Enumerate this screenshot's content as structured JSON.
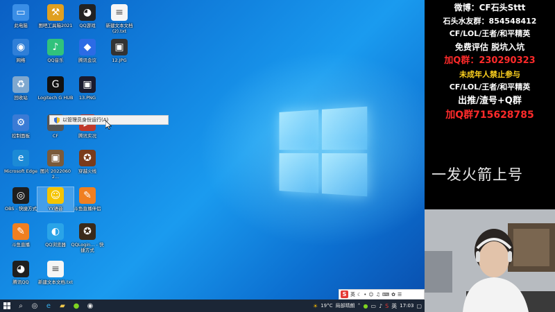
{
  "desktop": {
    "icons": [
      {
        "label": "此电脑",
        "icon": "computer-icon",
        "color": "#3a8ee6",
        "glyph": "▭"
      },
      {
        "label": "图吧工具箱2021",
        "icon": "toolbox-icon",
        "color": "#e0a020",
        "glyph": "⚒"
      },
      {
        "label": "QQ游戏",
        "icon": "qq-game-icon",
        "color": "#222222",
        "glyph": "◕"
      },
      {
        "label": "新建文本文档 (2).txt",
        "icon": "text-file-icon",
        "color": "#f5f5f5",
        "glyph": "≡"
      },
      {
        "label": "网络",
        "icon": "network-icon",
        "color": "#2f7fd8",
        "glyph": "◉"
      },
      {
        "label": "QQ音乐",
        "icon": "qq-music-icon",
        "color": "#31c27c",
        "glyph": "♪"
      },
      {
        "label": "腾讯会议",
        "icon": "tencent-meeting-icon",
        "color": "#2c6be5",
        "glyph": "◆"
      },
      {
        "label": "12.JPG",
        "icon": "image-file-icon",
        "color": "#333333",
        "glyph": "▣"
      },
      {
        "label": "回收站",
        "icon": "recycle-bin-icon",
        "color": "#7fa8cf",
        "glyph": "♻"
      },
      {
        "label": "Logitech G HUB",
        "icon": "logitech-icon",
        "color": "#111111",
        "glyph": "G"
      },
      {
        "label": "13.PNG",
        "icon": "image-file-icon",
        "color": "#1a1a2e",
        "glyph": "▣"
      },
      {
        "label": "控制面板",
        "icon": "control-panel-icon",
        "color": "#3a7bd5",
        "glyph": "⚙"
      },
      {
        "label": "CF",
        "icon": "cf-game-icon",
        "color": "#555555",
        "glyph": "✦"
      },
      {
        "label": "腾讯实况",
        "icon": "tencent-live-icon",
        "color": "#c0392b",
        "glyph": "▶"
      },
      {
        "label": "Microsoft Edge",
        "icon": "edge-icon",
        "color": "#1c8ad6",
        "glyph": "e"
      },
      {
        "label": "图片 20220602...",
        "icon": "photo-icon",
        "color": "#7a5a3a",
        "glyph": "▣"
      },
      {
        "label": "穿越火线",
        "icon": "crossfire-icon",
        "color": "#7a3b1a",
        "glyph": "✪"
      },
      {
        "label": "OBS - 快捷方式",
        "icon": "obs-icon",
        "color": "#1e1e1e",
        "glyph": "◎"
      },
      {
        "label": "YY语音",
        "icon": "yy-icon",
        "color": "#f5c400",
        "glyph": "☺"
      },
      {
        "label": "斗鱼直播伴侣",
        "icon": "douyu-companion-icon",
        "color": "#f07f20",
        "glyph": "✎"
      },
      {
        "label": "斗鱼直播",
        "icon": "douyu-icon",
        "color": "#f07f20",
        "glyph": "✎"
      },
      {
        "label": "QQ浏览器",
        "icon": "qq-browser-icon",
        "color": "#2aa4e8",
        "glyph": "◐"
      },
      {
        "label": "QQLogin... - 快捷方式",
        "icon": "qq-login-icon",
        "color": "#3a2a1a",
        "glyph": "✪"
      },
      {
        "label": "腾讯QQ",
        "icon": "qq-icon",
        "color": "#1f1f1f",
        "glyph": "◕"
      },
      {
        "label": "新建文本文档.txt",
        "icon": "text-file-icon",
        "color": "#f5f5f5",
        "glyph": "≡"
      }
    ],
    "context_item": "以管理员身份运行(A)"
  },
  "taskbar": {
    "weather": "19°C",
    "weather_desc": "局部晴朗",
    "clock": "17:03"
  },
  "ime": {
    "logo": "S",
    "lang": "英"
  },
  "side_panel": {
    "lines": [
      {
        "text": "微博：CF石头Sttt",
        "color": "#ffffff",
        "size": 12
      },
      {
        "text": "石头水友群：854548412",
        "color": "#ffffff",
        "size": 11
      },
      {
        "text": "CF/LOL/王者/和平精英",
        "color": "#ffffff",
        "size": 11
      },
      {
        "text": "免费评估 脱坑入坑",
        "color": "#ffffff",
        "size": 12
      },
      {
        "text": "加Q群：230290323",
        "color": "#ff2a2a",
        "size": 13
      },
      {
        "text": "未成年人禁止参与",
        "color": "#ffd21f",
        "size": 11
      },
      {
        "text": "CF/LOL/王者/和平精英",
        "color": "#ffffff",
        "size": 11
      },
      {
        "text": "出推/渣号+Q群",
        "color": "#ffffff",
        "size": 13
      },
      {
        "text": "加Q群715628785",
        "color": "#ff2a2a",
        "size": 14
      }
    ],
    "caption": "一发火箭上号"
  },
  "colors": {
    "desktop_blue": "#1284e0",
    "taskbar": "#1b2636",
    "accent_red": "#ff2a2a",
    "accent_yellow": "#ffd21f"
  }
}
